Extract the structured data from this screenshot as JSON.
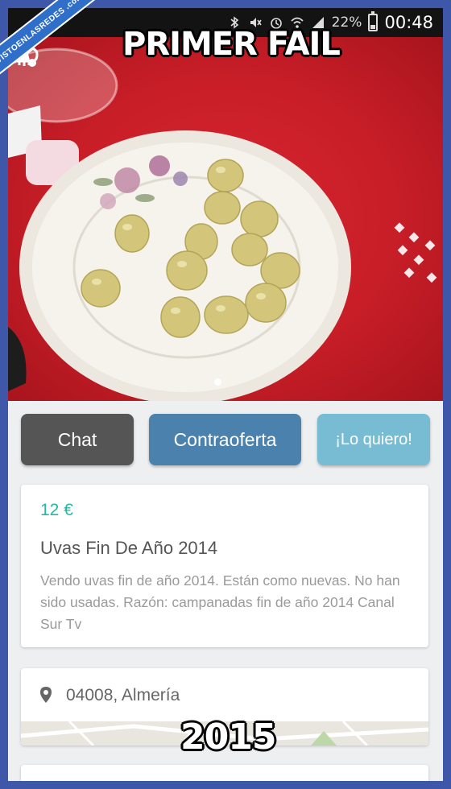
{
  "watermark": {
    "text": "VISTOENLASREDES .com"
  },
  "status_bar": {
    "battery": "22%",
    "time": "00:48"
  },
  "captions": {
    "top": "PRIMER FAIL",
    "bottom": "2015"
  },
  "photo": {
    "nav_icons": [
      "back-icon",
      "cloud-logo-icon",
      "star-icon",
      "share-icon"
    ]
  },
  "actions": {
    "chat_label": "Chat",
    "counter_offer_label": "Contraoferta",
    "want_label": "¡Lo quiero!"
  },
  "product": {
    "price": "12 €",
    "title": "Uvas Fin De Año 2014",
    "description": "Vendo uvas fin de año 2014. Están como nuevas. No han sido usadas. Razón: campanadas fin de año 2014 Canal Sur Tv"
  },
  "location": {
    "text": "04008, Almería"
  },
  "colors": {
    "chat_button": "#555555",
    "counter_offer_button": "#4a82ad",
    "want_button": "#78bcd4",
    "price": "#27b8a5",
    "background": "#eeeff1"
  }
}
